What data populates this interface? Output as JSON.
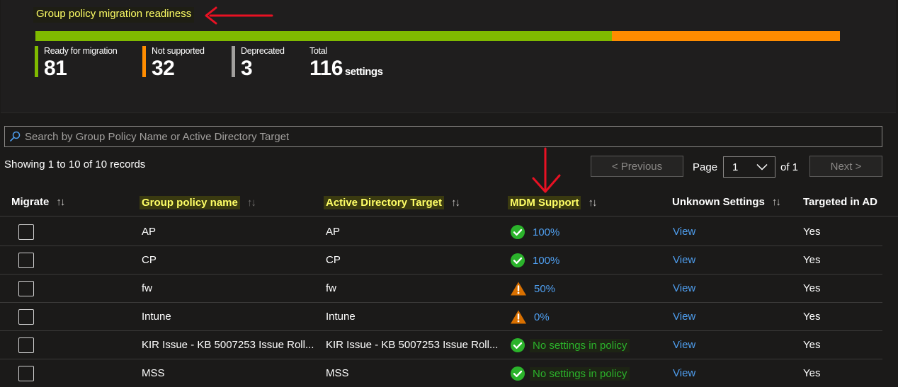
{
  "summary": {
    "title": "Group policy migration readiness",
    "bar": {
      "ready": 81,
      "not_supported": 32,
      "deprecated": 3,
      "total": 116
    },
    "stats": [
      {
        "label": "Ready for migration",
        "value": "81",
        "color": "#7fba00"
      },
      {
        "label": "Not supported",
        "value": "32",
        "color": "#ff8c00"
      },
      {
        "label": "Deprecated",
        "value": "3",
        "color": "#a19f9d"
      },
      {
        "label": "Total",
        "value": "116",
        "unit": "settings"
      }
    ]
  },
  "search": {
    "placeholder": "Search by Group Policy Name or Active Directory Target",
    "icon": "search-icon"
  },
  "pagination": {
    "showing": "Showing 1 to 10 of 10 records",
    "previous": "< Previous",
    "next": "Next >",
    "page_label": "Page",
    "page_value": "1",
    "of_label": "of 1"
  },
  "table": {
    "headers": [
      "Migrate",
      "Group policy name",
      "Active Directory Target",
      "MDM Support",
      "Unknown Settings",
      "Targeted in AD"
    ],
    "rows": [
      {
        "name": "AP",
        "target": "AP",
        "mdm_status": "ok",
        "mdm": "100%",
        "unknown": "View",
        "targeted": "Yes"
      },
      {
        "name": "CP",
        "target": "CP",
        "mdm_status": "ok",
        "mdm": "100%",
        "unknown": "View",
        "targeted": "Yes"
      },
      {
        "name": "fw",
        "target": "fw",
        "mdm_status": "warning",
        "mdm": "50%",
        "unknown": "View",
        "targeted": "Yes"
      },
      {
        "name": "Intune",
        "target": "Intune",
        "mdm_status": "warning",
        "mdm": "0%",
        "unknown": "View",
        "targeted": "Yes"
      },
      {
        "name": "KIR Issue - KB 5007253 Issue Roll...",
        "target": "KIR Issue - KB 5007253 Issue Roll...",
        "mdm_status": "ok",
        "mdm": "No settings in policy",
        "unknown": "View",
        "targeted": "Yes"
      },
      {
        "name": "MSS",
        "target": "MSS",
        "mdm_status": "ok",
        "mdm": "No settings in policy",
        "unknown": "View",
        "targeted": "Yes"
      }
    ]
  },
  "colors": {
    "ready": "#7fba00",
    "not_supported": "#ff8c00",
    "link": "#4f9ff0",
    "highlight": "#ffff66",
    "annotation": "#e81123"
  }
}
